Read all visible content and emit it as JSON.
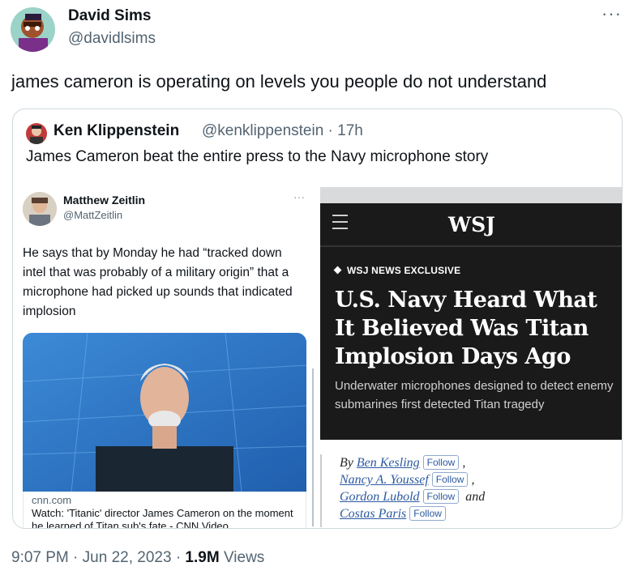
{
  "tweet": {
    "author_name": "David Sims",
    "author_handle": "@davidlsims",
    "more_icon": "···",
    "text": "james cameron is operating on levels you people do not understand",
    "time": "9:07 PM",
    "date": "Jun 22, 2023",
    "views_count": "1.9M",
    "views_label": "Views",
    "separator": "·"
  },
  "quote": {
    "author_name": "Ken Klippenstein",
    "author_handle": "@kenklippenstein · 17h",
    "text": "James Cameron beat the entire press to the Navy microphone story",
    "left_screenshot": {
      "name": "Matthew Zeitlin",
      "handle": "@MattZeitlin",
      "more": "···",
      "text": "He says that by Monday he had “tracked down intel that was probably of a military origin” that a microphone had picked up sounds that indicated implosion",
      "card_domain": "cnn.com",
      "card_title": "Watch: 'Titanic' director James Cameron on the moment he learned of Titan sub's fate - CNN Video"
    },
    "right_screenshot": {
      "logo": "WSJ",
      "kicker": "WSJ NEWS EXCLUSIVE",
      "headline": "U.S. Navy Heard What It Believed Was Titan Implosion Days Ago",
      "dek": "Underwater microphones designed to detect enemy submarines first detected Titan tragedy",
      "byline_prefix": "By",
      "authors": [
        "Ben Kesling",
        "Nancy A. Youssef",
        "Gordon Lubold",
        "Costas Paris"
      ],
      "follow_label": "Follow",
      "comma": ",",
      "and": "and"
    }
  },
  "colors": {
    "text_primary": "#0f1419",
    "text_secondary": "#536471",
    "border": "#cfd9de",
    "wsj_dark": "#1a1a1a",
    "link_blue": "#2c5aa0"
  }
}
